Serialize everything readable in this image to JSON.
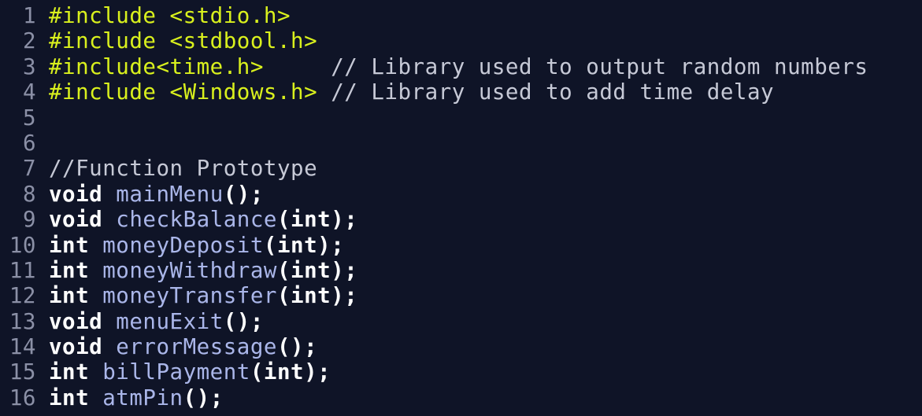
{
  "editor": {
    "lines": [
      {
        "num": "1",
        "tokens": [
          {
            "t": "pre",
            "v": "#include <stdio.h>"
          }
        ]
      },
      {
        "num": "2",
        "tokens": [
          {
            "t": "pre",
            "v": "#include <stdbool.h>"
          }
        ]
      },
      {
        "num": "3",
        "tokens": [
          {
            "t": "pre",
            "v": "#include<time.h>"
          },
          {
            "t": "cmt",
            "v": "     // Library used to output random numbers"
          }
        ]
      },
      {
        "num": "4",
        "tokens": [
          {
            "t": "pre",
            "v": "#include <Windows.h>"
          },
          {
            "t": "cmt",
            "v": " // Library used to add time delay"
          }
        ]
      },
      {
        "num": "5",
        "tokens": []
      },
      {
        "num": "6",
        "tokens": []
      },
      {
        "num": "7",
        "tokens": [
          {
            "t": "cmt",
            "v": "//Function Prototype"
          }
        ]
      },
      {
        "num": "8",
        "tokens": [
          {
            "t": "kw",
            "v": "void"
          },
          {
            "t": "plain",
            "v": " "
          },
          {
            "t": "fn",
            "v": "mainMenu"
          },
          {
            "t": "pun",
            "v": "();"
          }
        ]
      },
      {
        "num": "9",
        "tokens": [
          {
            "t": "kw",
            "v": "void"
          },
          {
            "t": "plain",
            "v": " "
          },
          {
            "t": "fn",
            "v": "checkBalance"
          },
          {
            "t": "pun",
            "v": "(int);"
          }
        ]
      },
      {
        "num": "10",
        "tokens": [
          {
            "t": "kw",
            "v": "int"
          },
          {
            "t": "plain",
            "v": " "
          },
          {
            "t": "fn",
            "v": "moneyDeposit"
          },
          {
            "t": "pun",
            "v": "(int);"
          }
        ]
      },
      {
        "num": "11",
        "tokens": [
          {
            "t": "kw",
            "v": "int"
          },
          {
            "t": "plain",
            "v": " "
          },
          {
            "t": "fn",
            "v": "moneyWithdraw"
          },
          {
            "t": "pun",
            "v": "(int);"
          }
        ]
      },
      {
        "num": "12",
        "tokens": [
          {
            "t": "kw",
            "v": "int"
          },
          {
            "t": "plain",
            "v": " "
          },
          {
            "t": "fn",
            "v": "moneyTransfer"
          },
          {
            "t": "pun",
            "v": "(int);"
          }
        ]
      },
      {
        "num": "13",
        "tokens": [
          {
            "t": "kw",
            "v": "void"
          },
          {
            "t": "plain",
            "v": " "
          },
          {
            "t": "fn",
            "v": "menuExit"
          },
          {
            "t": "pun",
            "v": "();"
          }
        ]
      },
      {
        "num": "14",
        "tokens": [
          {
            "t": "kw",
            "v": "void"
          },
          {
            "t": "plain",
            "v": " "
          },
          {
            "t": "fn",
            "v": "errorMessage"
          },
          {
            "t": "pun",
            "v": "();"
          }
        ]
      },
      {
        "num": "15",
        "tokens": [
          {
            "t": "kw",
            "v": "int"
          },
          {
            "t": "plain",
            "v": " "
          },
          {
            "t": "fn",
            "v": "billPayment"
          },
          {
            "t": "pun",
            "v": "(int);"
          }
        ]
      },
      {
        "num": "16",
        "tokens": [
          {
            "t": "kw",
            "v": "int"
          },
          {
            "t": "plain",
            "v": " "
          },
          {
            "t": "fn",
            "v": "atmPin"
          },
          {
            "t": "pun",
            "v": "();"
          }
        ]
      }
    ]
  },
  "colors": {
    "background": "#0f1427",
    "preprocessor": "#d9f01d",
    "comment": "#c6c9d6",
    "keyword": "#ffffff",
    "function": "#aab6e9",
    "line_number": "#8b90a6"
  }
}
